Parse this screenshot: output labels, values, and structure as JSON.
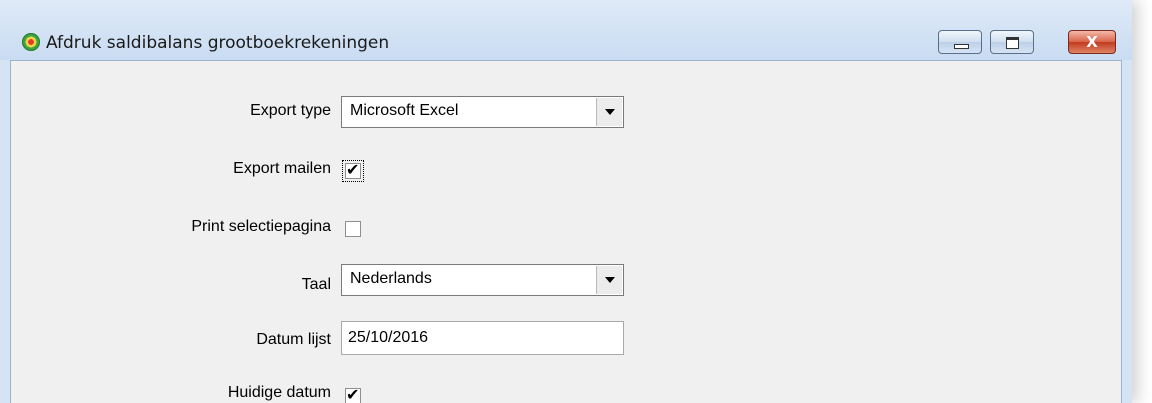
{
  "window": {
    "title": "Afdruk saldibalans grootboekrekeningen",
    "app_icon": "colorful-globe-icon",
    "controls": {
      "minimize": "minimize-icon",
      "maximize": "maximize-icon",
      "close_label": "X"
    }
  },
  "form": {
    "export_type": {
      "label": "Export type",
      "value": "Microsoft Excel"
    },
    "export_mailen": {
      "label": "Export mailen",
      "checked": true,
      "check_glyph": "✔"
    },
    "print_selectiepagina": {
      "label": "Print selectiepagina",
      "checked": false,
      "check_glyph": ""
    },
    "taal": {
      "label": "Taal",
      "value": "Nederlands"
    },
    "datum_lijst": {
      "label": "Datum lijst",
      "value": "25/10/2016"
    },
    "huidige_datum": {
      "label": "Huidige datum",
      "checked": true,
      "check_glyph": "✔"
    }
  },
  "colors": {
    "title_bar": "#dfeaf7",
    "client_area": "#f0f0f0",
    "close_button": "#c23b1f"
  }
}
